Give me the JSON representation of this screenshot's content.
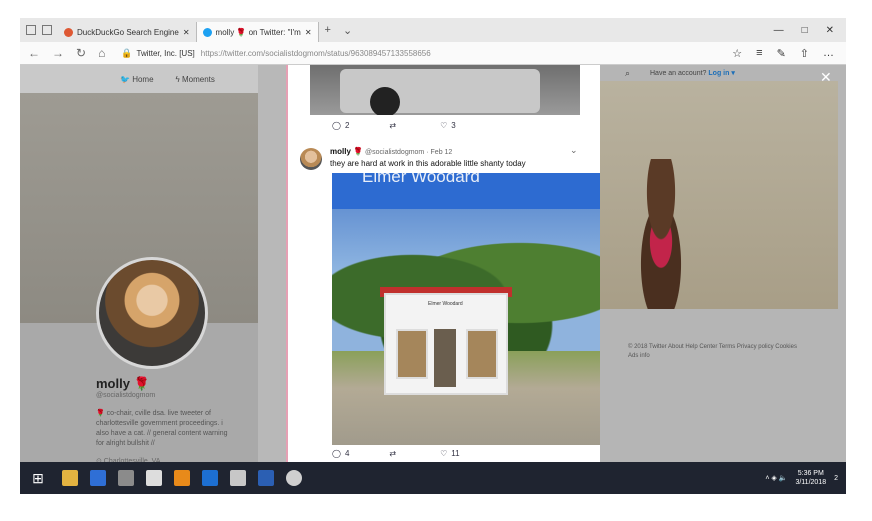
{
  "browser": {
    "tabs": [
      {
        "label": "DuckDuckGo Search Engine",
        "active": false,
        "favicon_color": "#de5833"
      },
      {
        "label": "molly 🌹 on Twitter: \"I'm",
        "active": true,
        "favicon_color": "#1da1f2"
      }
    ],
    "new_tab": "+",
    "tab_menu": "⌄",
    "window_controls": [
      "—",
      "□",
      "✕"
    ],
    "nav_buttons": [
      "←",
      "→",
      "↻",
      "⌂"
    ],
    "site_identity": "Twitter, Inc. [US]",
    "url": "https://twitter.com/socialistdogmom/status/963089457133558656",
    "right_buttons": [
      "☆",
      "≡",
      "✎",
      "⇧",
      "…"
    ]
  },
  "twitter_nav": {
    "home": "Home",
    "moments": "Moments"
  },
  "profile": {
    "name": "molly 🌹",
    "handle": "@socialistdogmom",
    "bio": "🌹 co-chair, cville dsa. live tweeter of charlottesville government proceedings. i also have a cat. // general content warning for alright bullshit //",
    "location": "⊙ Charlottesville, VA"
  },
  "prev_tweet_actions": {
    "reply": "2",
    "retweet": "",
    "like": "3"
  },
  "tweet": {
    "author": "molly 🌹",
    "handle": "@socialistdogmom",
    "date": "Feb 12",
    "text": "they are hard at work in this adorable little shanty today",
    "image_banner": "Elmer Woodard",
    "sign_text": "Elmer Woodard",
    "actions": {
      "reply": "4",
      "retweet": "",
      "like": "11"
    }
  },
  "right_panel": {
    "login_prompt": "Have an account?",
    "login_link": "Log in ▾",
    "footer": "© 2018 Twitter  About  Help Center  Terms  Privacy policy  Cookies  Ads info"
  },
  "close_label": "✕",
  "taskbar": {
    "time": "5:36 PM",
    "date": "3/11/2018",
    "tray_icons": "˄ ◈ 🔈",
    "notif": "2"
  }
}
